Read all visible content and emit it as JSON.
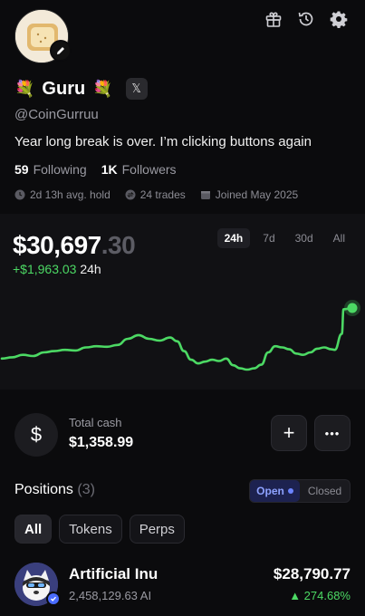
{
  "profile": {
    "name": "Guru",
    "flower_left": "💐",
    "flower_right": "💐",
    "x_label": "𝕏",
    "handle": "@CoinGurruu",
    "bio": "Year long break is over. I’m clicking buttons again",
    "following_count": "59",
    "following_label": "Following",
    "followers_count": "1K",
    "followers_label": "Followers",
    "avg_hold": "2d 13h avg. hold",
    "trades": "24 trades",
    "joined": "Joined May 2025"
  },
  "icons": {
    "gift": "gift-icon",
    "history": "history-icon",
    "settings": "gear-icon",
    "edit": "pencil-icon"
  },
  "portfolio": {
    "balance_main": "$30,697",
    "balance_decimals": ".30",
    "change_value": "+$1,963.03",
    "change_period": "24h",
    "ranges": [
      "24h",
      "7d",
      "30d",
      "All"
    ],
    "active_range": "24h"
  },
  "chart_data": {
    "type": "line",
    "color": "#4cd964",
    "points": [
      [
        0,
        0.18
      ],
      [
        0.03,
        0.2
      ],
      [
        0.06,
        0.24
      ],
      [
        0.09,
        0.22
      ],
      [
        0.12,
        0.28
      ],
      [
        0.15,
        0.3
      ],
      [
        0.18,
        0.32
      ],
      [
        0.21,
        0.31
      ],
      [
        0.24,
        0.36
      ],
      [
        0.27,
        0.38
      ],
      [
        0.3,
        0.37
      ],
      [
        0.33,
        0.4
      ],
      [
        0.36,
        0.5
      ],
      [
        0.39,
        0.56
      ],
      [
        0.42,
        0.5
      ],
      [
        0.45,
        0.47
      ],
      [
        0.48,
        0.52
      ],
      [
        0.5,
        0.46
      ],
      [
        0.52,
        0.3
      ],
      [
        0.54,
        0.16
      ],
      [
        0.56,
        0.1
      ],
      [
        0.58,
        0.13
      ],
      [
        0.6,
        0.16
      ],
      [
        0.62,
        0.14
      ],
      [
        0.64,
        0.18
      ],
      [
        0.66,
        0.07
      ],
      [
        0.68,
        0.02
      ],
      [
        0.7,
        0.0
      ],
      [
        0.72,
        0.02
      ],
      [
        0.74,
        0.08
      ],
      [
        0.76,
        0.28
      ],
      [
        0.78,
        0.38
      ],
      [
        0.8,
        0.36
      ],
      [
        0.82,
        0.33
      ],
      [
        0.84,
        0.26
      ],
      [
        0.86,
        0.24
      ],
      [
        0.88,
        0.28
      ],
      [
        0.9,
        0.34
      ],
      [
        0.92,
        0.36
      ],
      [
        0.94,
        0.33
      ],
      [
        0.95,
        0.32
      ],
      [
        0.97,
        0.58
      ],
      [
        0.975,
        0.98
      ],
      [
        1.0,
        1.0
      ]
    ]
  },
  "cash": {
    "symbol": "$",
    "label": "Total cash",
    "value": "$1,358.99",
    "add_label": "+",
    "more_label": "•••"
  },
  "positions": {
    "title": "Positions",
    "count": "(3)",
    "open_label": "Open",
    "closed_label": "Closed",
    "filters": [
      "All",
      "Tokens",
      "Perps"
    ],
    "items": [
      {
        "name": "Artificial Inu",
        "amount": "2,458,129.63 AI",
        "value": "$28,790.77",
        "change": "▲ 274.68%"
      }
    ]
  }
}
